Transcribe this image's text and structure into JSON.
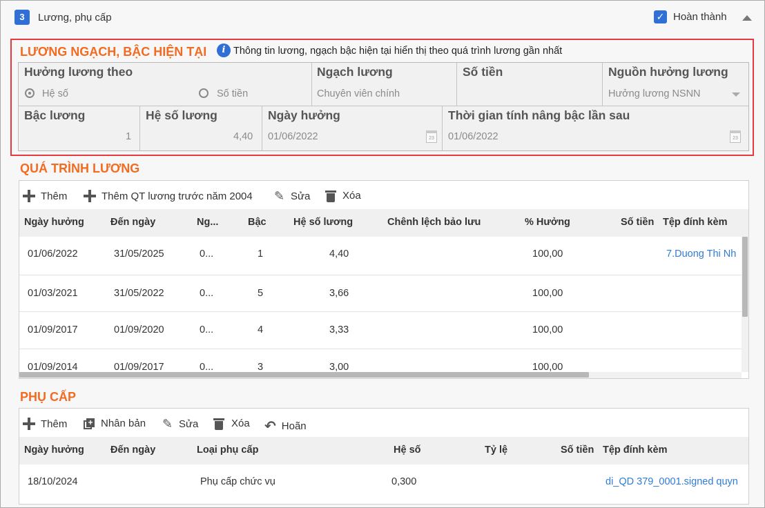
{
  "section": {
    "number": "3",
    "title": "Lương, phụ cấp",
    "complete_label": "Hoàn thành",
    "complete_checked": true
  },
  "current": {
    "heading": "LƯƠNG NGẠCH, BẬC HIỆN TẠI",
    "info_text": "Thông tin lương, ngạch bậc hiện tại hiển thị theo quá trình lương gần nhất",
    "salary_by_label": "Hưởng lương theo",
    "radio_coef": "Hệ số",
    "radio_amount": "Số tiền",
    "rank_label": "Ngạch lương",
    "rank_value": "Chuyên viên chính",
    "amount_label": "Số tiền",
    "amount_value": "",
    "source_label": "Nguồn hưởng lương",
    "source_value": "Hưởng lương NSNN",
    "step_label": "Bậc lương",
    "step_value": "1",
    "coef_label": "Hệ số lương",
    "coef_value": "4,40",
    "date_label": "Ngày hưởng",
    "date_value": "01/06/2022",
    "next_label": "Thời gian tính nâng bậc lần sau",
    "next_value": "01/06/2022",
    "cal_day": "23"
  },
  "process": {
    "heading": "QUÁ TRÌNH LƯƠNG",
    "toolbar": {
      "add": "Thêm",
      "add_before": "Thêm QT lương trước năm 2004",
      "edit": "Sửa",
      "delete": "Xóa"
    },
    "columns": [
      "Ngày hưởng",
      "Đến ngày",
      "Ng...",
      "Bậc",
      "Hệ số lương",
      "Chênh lệch bảo lưu",
      "% Hưởng",
      "Số tiền",
      "Tệp đính kèm"
    ],
    "rows": [
      [
        "01/06/2022",
        "31/05/2025",
        "0...",
        "1",
        "4,40",
        "",
        "100,00",
        "",
        "7.Duong Thi Nh"
      ],
      [
        "01/03/2021",
        "31/05/2022",
        "0...",
        "5",
        "3,66",
        "",
        "100,00",
        "",
        ""
      ],
      [
        "01/09/2017",
        "01/09/2020",
        "0...",
        "4",
        "3,33",
        "",
        "100,00",
        "",
        ""
      ],
      [
        "01/09/2014",
        "01/09/2017",
        "0...",
        "3",
        "3,00",
        "",
        "100,00",
        "",
        ""
      ]
    ]
  },
  "allowance": {
    "heading": "PHỤ CẤP",
    "toolbar": {
      "add": "Thêm",
      "duplicate": "Nhân bản",
      "edit": "Sửa",
      "delete": "Xóa",
      "undo": "Hoãn"
    },
    "columns": [
      "Ngày hưởng",
      "Đến ngày",
      "Loại phụ cấp",
      "Hệ số",
      "Tỷ lệ",
      "Số tiền",
      "Tệp đính kèm"
    ],
    "rows": [
      [
        "18/10/2024",
        "",
        "Phụ cấp chức vụ",
        "0,300",
        "",
        "",
        "di_QD 379_0001.signed quyn"
      ]
    ]
  }
}
